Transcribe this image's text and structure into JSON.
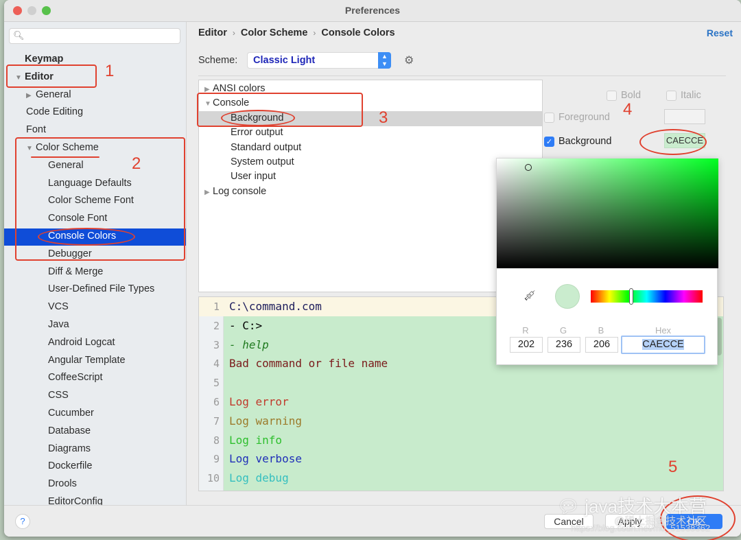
{
  "window": {
    "title": "Preferences"
  },
  "sidebar": {
    "search_placeholder": "",
    "items": [
      {
        "label": "Keymap",
        "level": 0,
        "bold": true
      },
      {
        "label": "Editor",
        "level": 0,
        "bold": true,
        "arrow": "expanded"
      },
      {
        "label": "General",
        "level": 1,
        "arrow": "collapsed"
      },
      {
        "label": "Code Editing",
        "level": 1
      },
      {
        "label": "Font",
        "level": 1
      },
      {
        "label": "Color Scheme",
        "level": 1,
        "arrow": "expanded"
      },
      {
        "label": "General",
        "level": 2
      },
      {
        "label": "Language Defaults",
        "level": 2
      },
      {
        "label": "Color Scheme Font",
        "level": 2
      },
      {
        "label": "Console Font",
        "level": 2
      },
      {
        "label": "Console Colors",
        "level": 2,
        "selected": true
      },
      {
        "label": "Debugger",
        "level": 2
      },
      {
        "label": "Diff & Merge",
        "level": 2
      },
      {
        "label": "User-Defined File Types",
        "level": 2
      },
      {
        "label": "VCS",
        "level": 2
      },
      {
        "label": "Java",
        "level": 2
      },
      {
        "label": "Android Logcat",
        "level": 2
      },
      {
        "label": "Angular Template",
        "level": 2
      },
      {
        "label": "CoffeeScript",
        "level": 2
      },
      {
        "label": "CSS",
        "level": 2
      },
      {
        "label": "Cucumber",
        "level": 2
      },
      {
        "label": "Database",
        "level": 2
      },
      {
        "label": "Diagrams",
        "level": 2
      },
      {
        "label": "Dockerfile",
        "level": 2
      },
      {
        "label": "Drools",
        "level": 2
      },
      {
        "label": "EditorConfig",
        "level": 2
      }
    ]
  },
  "main": {
    "breadcrumb": [
      "Editor",
      "Color Scheme",
      "Console Colors"
    ],
    "breadcrumb_sep": "›",
    "reset_label": "Reset",
    "scheme_label": "Scheme:",
    "scheme_value": "Classic Light",
    "attributes": [
      {
        "label": "ANSI colors",
        "level": 0,
        "arrow": "collapsed"
      },
      {
        "label": "Console",
        "level": 0,
        "arrow": "expanded"
      },
      {
        "label": "Background",
        "level": 1,
        "selected": true
      },
      {
        "label": "Error output",
        "level": 1
      },
      {
        "label": "Standard output",
        "level": 1
      },
      {
        "label": "System output",
        "level": 1
      },
      {
        "label": "User input",
        "level": 1
      },
      {
        "label": "Log console",
        "level": 0,
        "arrow": "collapsed"
      }
    ],
    "options": {
      "bold_label": "Bold",
      "italic_label": "Italic",
      "foreground_label": "Foreground",
      "foreground_checked": false,
      "background_label": "Background",
      "background_checked": true,
      "background_value": "CAECCE"
    },
    "preview_lines": [
      {
        "n": "1",
        "text": "C:\\command.com",
        "color": "#1d1d5c"
      },
      {
        "n": "2",
        "text": "- C:>",
        "color": "#000000"
      },
      {
        "n": "3",
        "text": "- help",
        "color": "#1f7a1f",
        "italic_from": 2
      },
      {
        "n": "4",
        "text": "Bad command or file name",
        "color": "#7a1a1a"
      },
      {
        "n": "5",
        "text": "",
        "color": "#000000"
      },
      {
        "n": "6",
        "text": "Log error",
        "color": "#c0392b"
      },
      {
        "n": "7",
        "text": "Log warning",
        "color": "#9c7a2a"
      },
      {
        "n": "8",
        "text": "Log info",
        "color": "#2ebf2e"
      },
      {
        "n": "9",
        "text": "Log verbose",
        "color": "#1f2fb8"
      },
      {
        "n": "10",
        "text": "Log debug",
        "color": "#35bfbf"
      }
    ],
    "preview_bg": "#caecce"
  },
  "color_picker": {
    "r_label": "R",
    "g_label": "G",
    "b_label": "B",
    "hex_label": "Hex",
    "r": "202",
    "g": "236",
    "b": "206",
    "hex": "CAECCE",
    "hue_position": 0.36
  },
  "footer": {
    "help_label": "?",
    "cancel_label": "Cancel",
    "apply_label": "Apply",
    "ok_label": "OK"
  },
  "annotations": {
    "n1": "1",
    "n2": "2",
    "n3": "3",
    "n4": "4",
    "n5": "5"
  },
  "watermark": {
    "main": "java技术大本营",
    "sub": "@稀土掘金技术社区",
    "url": "https://blog.csdn.net/m0_51538362"
  }
}
